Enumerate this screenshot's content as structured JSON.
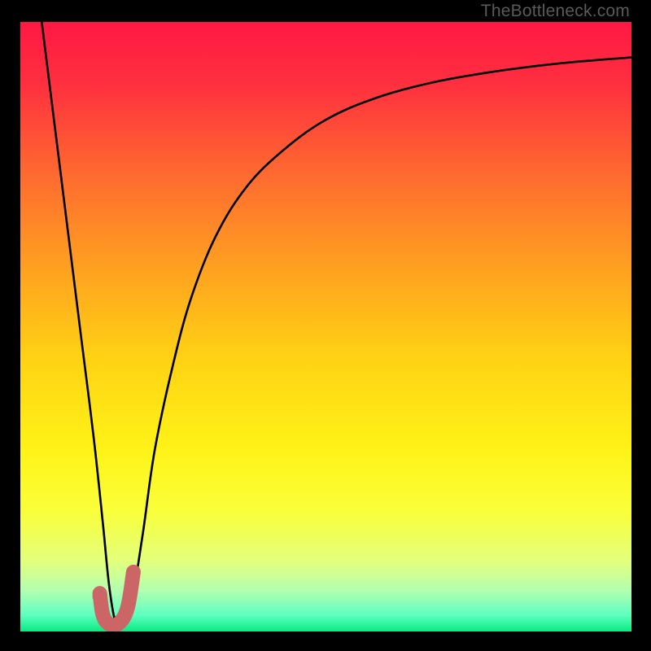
{
  "watermark": "TheBottleneck.com",
  "chart_data": {
    "type": "line",
    "title": "",
    "xlabel": "",
    "ylabel": "",
    "xlim": [
      0,
      100
    ],
    "ylim": [
      0,
      100
    ],
    "gradient_stops": [
      {
        "offset": 0.0,
        "color": "#ff1844"
      },
      {
        "offset": 0.1,
        "color": "#ff2f3f"
      },
      {
        "offset": 0.25,
        "color": "#ff6a30"
      },
      {
        "offset": 0.4,
        "color": "#ffa020"
      },
      {
        "offset": 0.55,
        "color": "#ffd214"
      },
      {
        "offset": 0.7,
        "color": "#fff317"
      },
      {
        "offset": 0.8,
        "color": "#faff3a"
      },
      {
        "offset": 0.88,
        "color": "#e4ff7a"
      },
      {
        "offset": 0.93,
        "color": "#b4ffb0"
      },
      {
        "offset": 0.97,
        "color": "#60ffc0"
      },
      {
        "offset": 1.0,
        "color": "#00e87a"
      }
    ],
    "series": [
      {
        "name": "bottleneck-curve",
        "color": "#000000",
        "x": [
          3.5,
          6,
          8,
          10,
          12,
          13.5,
          14.5,
          15.5,
          16.5,
          18,
          20,
          22,
          25,
          28,
          32,
          37,
          43,
          50,
          58,
          67,
          77,
          88,
          100
        ],
        "y": [
          100,
          80,
          64,
          48,
          32,
          18,
          8,
          2,
          1,
          4,
          16,
          30,
          44,
          55,
          65,
          73,
          79,
          84,
          87.5,
          90,
          91.8,
          93.2,
          94.2
        ]
      },
      {
        "name": "highlight-tick",
        "color": "#cc6666",
        "type": "path",
        "comment": "Small pink J-shaped tick mark near curve minimum",
        "x": [
          13.0,
          13.5,
          14.5,
          16.0,
          17.5,
          18.5
        ],
        "y": [
          6.5,
          3.0,
          1.5,
          1.5,
          4.0,
          10.0
        ]
      }
    ],
    "markers": [
      {
        "name": "highlight-dot",
        "x": 13.0,
        "y": 6.0,
        "r": 1.2,
        "color": "#cc6666"
      }
    ]
  }
}
